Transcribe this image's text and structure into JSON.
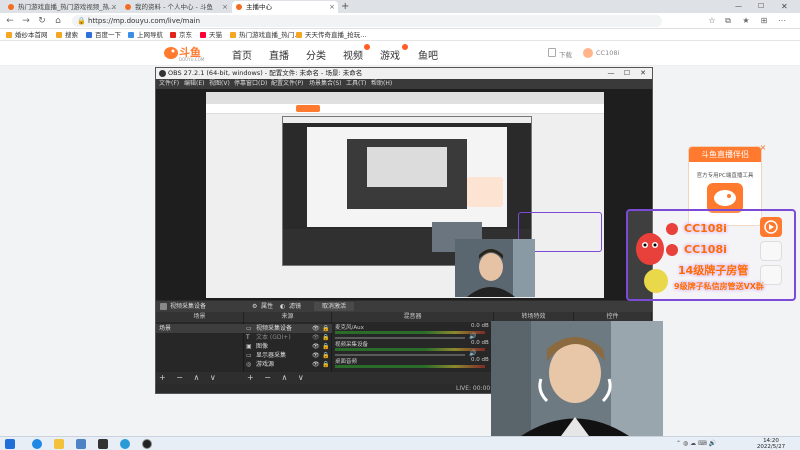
{
  "browser": {
    "tabs": [
      {
        "label": "热门游戏直播_热门游戏视频_热..."
      },
      {
        "label": "我的资料 - 个人中心 - 斗鱼"
      },
      {
        "label": "主播中心"
      }
    ],
    "new_tab": "+",
    "url": "https://mp.douyu.com/live/main",
    "bookmarks": [
      "婚纱本首网",
      "搜索",
      "百度一下",
      "上网导航",
      "京东",
      "天猫",
      "热门游戏直播_热门...",
      "天天传奇直播_抢玩..."
    ]
  },
  "site": {
    "logo_text": "斗鱼",
    "logo_sub": "DOUYU.COM",
    "nav": [
      "首页",
      "直播",
      "分类",
      "视频",
      "游戏",
      "鱼吧"
    ],
    "download_label": "下载",
    "username": "CC108i"
  },
  "obs": {
    "title": "OBS 27.2.1 (64-bit, windows) - 配置文件: 未命名 - 场景: 未命名",
    "menu": [
      "文件(F)",
      "编辑(E)",
      "视图(V)",
      "停靠窗口(D)",
      "配置文件(P)",
      "场景集合(S)",
      "工具(T)",
      "帮助(H)"
    ],
    "source_bar": {
      "source_name": "视频采集设备",
      "properties": "属性",
      "filters": "滤镜",
      "deactivate": "取消激活"
    },
    "docks": {
      "scenes": "场景",
      "sources": "来源",
      "mixer": "混音器",
      "transitions": "转场特效",
      "controls": "控件"
    },
    "scene_items": [
      "场景"
    ],
    "source_items": [
      {
        "icon": "camera-icon",
        "label": "视频采集设备"
      },
      {
        "icon": "text-icon",
        "label": "文本 (GDI+)"
      },
      {
        "icon": "image-icon",
        "label": "图像"
      },
      {
        "icon": "monitor-icon",
        "label": "显示器采集"
      },
      {
        "icon": "game-icon",
        "label": "游戏源"
      }
    ],
    "mixer_items": [
      {
        "name": "麦克风/Aux",
        "db": "0.0 dB"
      },
      {
        "name": "视频采集设备",
        "db": "0.0 dB"
      },
      {
        "name": "桌面音频",
        "db": "0.0 dB"
      }
    ],
    "footer_controls": "+ − ∧ ∨",
    "status_fps": "LIVE: 00:00:00  REC: 00:00:00  CPU: 2.6%, 30.00 fps"
  },
  "overlay": {
    "promo_title": "斗鱼直播伴侣",
    "promo_sub": "官方专用PC端直播工具",
    "user_label": "CC108i",
    "level_label": "14级牌子房管",
    "slogan": "9级牌子私信房管送VX群",
    "close": "×"
  },
  "taskbar": {
    "time": "14:20",
    "date": "2022/5/27"
  },
  "colors": {
    "accent": "#ff7a2e",
    "obs_bg": "#2b2b2b",
    "overlay_border": "#7b4ad6"
  }
}
